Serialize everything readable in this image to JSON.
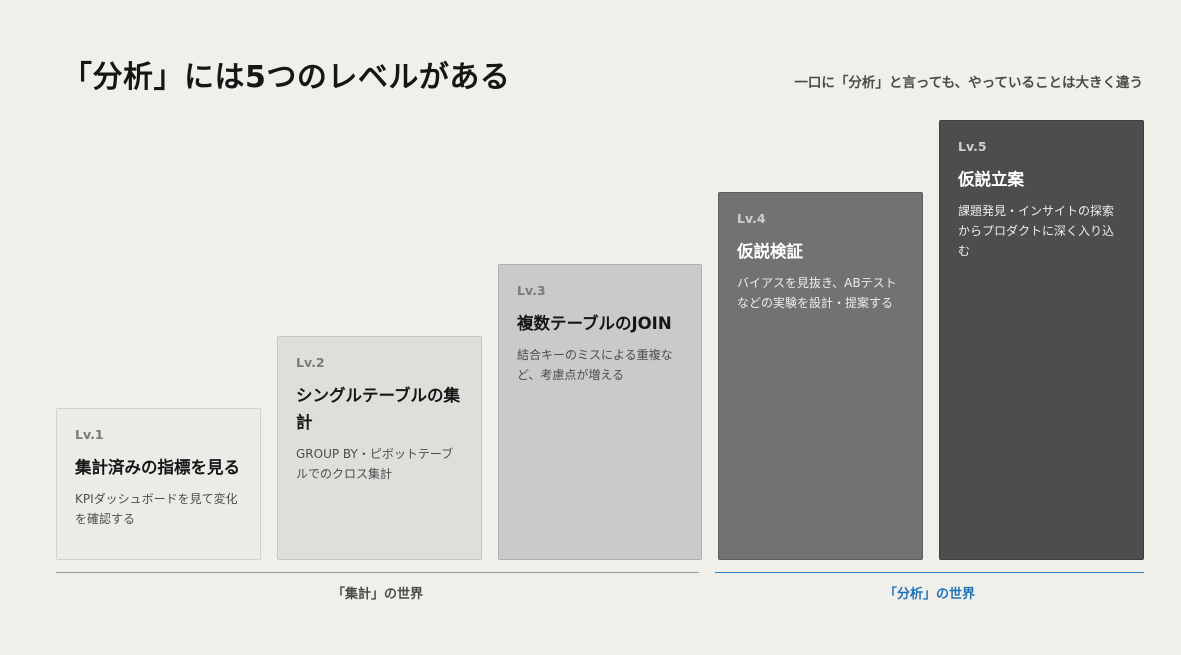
{
  "header": {
    "title": "「分析」には5つのレベルがある",
    "subtitle": "一口に「分析」と言っても、やっていることは大きく違う"
  },
  "levels": [
    {
      "level": "Lv.1",
      "name": "集計済みの指標を見る",
      "description": "KPIダッシュボードを見て変化を確認する"
    },
    {
      "level": "Lv.2",
      "name": "シングルテーブルの集計",
      "description": "GROUP BY・ピボットテーブルでのクロス集計"
    },
    {
      "level": "Lv.3",
      "name": "複数テーブルのJOIN",
      "description": "結合キーのミスによる重複など、考慮点が増える"
    },
    {
      "level": "Lv.4",
      "name": "仮説検証",
      "description": "バイアスを見抜き、ABテストなどの実験を設計・提案する"
    },
    {
      "level": "Lv.5",
      "name": "仮説立案",
      "description": "課題発見・インサイトの探索からプロダクトに深く入り込む"
    }
  ],
  "groups": {
    "left": "「集計」の世界",
    "right": "「分析」の世界"
  },
  "colors": {
    "background": "#f1efe9",
    "accent": "#1f74b8"
  }
}
